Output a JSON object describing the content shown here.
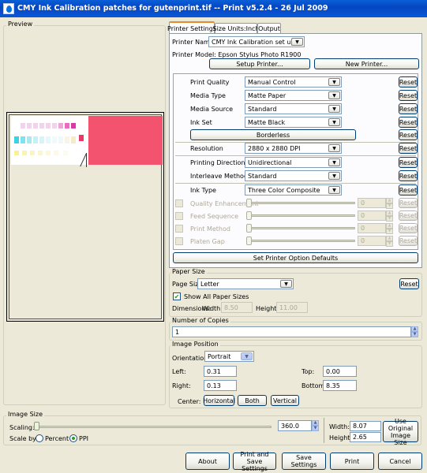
{
  "window": {
    "title": "CMY Ink Calibration patches for gutenprint.tif -- Print v5.2.4 - 26 Jul 2009"
  },
  "preview": {
    "label": "Preview"
  },
  "tabs": [
    {
      "label": "Printer Settings"
    },
    {
      "label": "Size Units:Inch"
    },
    {
      "label": "Output"
    }
  ],
  "printer": {
    "name_label": "Printer Name:",
    "name_value": "CMY Ink Calibration set up",
    "model_text": "Printer Model: Epson Stylus Photo R1900",
    "setup_button": "Setup Printer...",
    "new_button": "New Printer..."
  },
  "options": [
    {
      "label": "Print Quality",
      "value": "Manual Control",
      "reset": "Reset"
    },
    {
      "label": "Media Type",
      "value": "Matte Paper",
      "reset": "Reset"
    },
    {
      "label": "Media Source",
      "value": "Standard",
      "reset": "Reset"
    },
    {
      "label": "Ink Set",
      "value": "Matte Black",
      "reset": "Reset"
    }
  ],
  "borderless": {
    "label": "Borderless",
    "reset": "Reset"
  },
  "options2": [
    {
      "label": "Resolution",
      "value": "2880 x 2880 DPI",
      "reset": "Reset"
    },
    {
      "label": "Printing Direction",
      "value": "Unidirectional",
      "reset": "Reset"
    },
    {
      "label": "Interleave Method",
      "value": "Standard",
      "reset": "Reset"
    },
    {
      "label": "Ink Type",
      "value": "Three Color Composite",
      "reset": "Reset"
    }
  ],
  "sliders": [
    {
      "label": "Quality Enhancement",
      "value": "0",
      "reset": "Reset"
    },
    {
      "label": "Feed Sequence",
      "value": "0",
      "reset": "Reset"
    },
    {
      "label": "Print Method",
      "value": "0",
      "reset": "Reset"
    },
    {
      "label": "Platen Gap",
      "value": "0",
      "reset": "Reset"
    }
  ],
  "set_defaults_button": "Set Printer Option Defaults",
  "paper": {
    "group_label": "Paper Size",
    "size_label": "Page Size",
    "size_value": "Letter",
    "reset": "Reset",
    "show_all_label": "Show All Paper Sizes",
    "dimensions_label": "Dimensions:",
    "width_label": "Width:",
    "width_value": "8.50",
    "height_label": "Height:",
    "height_value": "11.00"
  },
  "copies": {
    "group_label": "Number of Copies",
    "value": "1"
  },
  "position": {
    "group_label": "Image Position",
    "orientation_label": "Orientation:",
    "orientation_value": "Portrait",
    "left_label": "Left:",
    "left_value": "0.31",
    "top_label": "Top:",
    "top_value": "0.00",
    "right_label": "Right:",
    "right_value": "0.13",
    "bottom_label": "Bottom:",
    "bottom_value": "8.35",
    "center_label": "Center:",
    "horizontal_button": "Horizontal",
    "both_button": "Both",
    "vertical_button": "Vertical"
  },
  "image_size": {
    "group_label": "Image Size",
    "scaling_label": "Scaling:",
    "scaling_value": "360.0",
    "scale_by_label": "Scale by:",
    "percent_label": "Percent",
    "ppi_label": "PPI",
    "width_label": "Width:",
    "width_value": "8.07",
    "height_label": "Height:",
    "height_value": "2.65",
    "use_original_button": "Use Original Image Size"
  },
  "footer": {
    "about": "About",
    "print_save": "Print and Save Settings",
    "save": "Save Settings",
    "print": "Print",
    "cancel": "Cancel"
  },
  "colors": {
    "titlebar": "#0a57d6",
    "preview_image_red": "#f3536e",
    "accent_green": "#21a121"
  },
  "icons": {
    "window_icon": "gimp-print-icon",
    "dropdown": "chevron-down-icon"
  }
}
